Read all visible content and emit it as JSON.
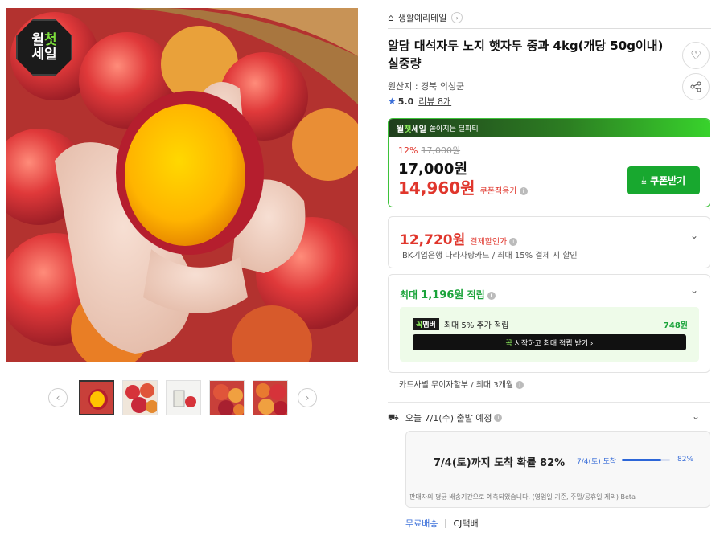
{
  "gallery": {
    "badge_line1": "월",
    "badge_line1_accent": "첫",
    "badge_line2": "세일",
    "thumbnails": [
      "thumb-1",
      "thumb-2",
      "thumb-3",
      "thumb-4",
      "thumb-5"
    ],
    "prev_icon": "chevron-left-icon",
    "next_icon": "chevron-right-icon"
  },
  "product": {
    "breadcrumb": "생활예리테일",
    "title": "알담 대석자두 노지 햇자두 중과 4kg(개당 50g이내) 실중량",
    "origin": "원산지 : 경북 의성군",
    "rating": "5.0",
    "review_link": "리뷰 8개"
  },
  "deal": {
    "header_prefix": "월",
    "header_accent": "첫",
    "header_suffix": "세일",
    "header_sub": "쏟아지는 딜파티",
    "discount_rate": "12%",
    "list_price": "17,000원",
    "sale_price": "17,000원",
    "coupon_price": "14,960원",
    "coupon_note": "쿠폰적용가",
    "coupon_button": "쿠폰받기"
  },
  "payment": {
    "price": "12,720원",
    "note": "결제할인가",
    "desc": "IBK기업은행 나라사랑카드 / 최대 15% 결제 시 할인"
  },
  "points": {
    "prefix": "최대",
    "amount": "1,196원",
    "suffix": "적립",
    "member_tag_accent": "꼭",
    "member_tag": "멤버",
    "member_text": "최대 5% 추가 적립",
    "member_amount": "748원",
    "cta_accent": "꼭",
    "cta": "시작하고 최대 적립 받기 ›"
  },
  "installment": "카드사별 무이자할부 / 최대 3개월",
  "shipping": {
    "departure": "오늘 7/1(수) 출발 예정",
    "arrival_headline": "7/4(토)까지 도착 확률 82%",
    "arrival_date": "7/4(토) 도착",
    "probability": 0.82,
    "probability_label": "82%",
    "footnote": "판매자의 평균 배송기간으로 예측되었습니다. (영업일 기준, 주말/공휴일 제외) Beta",
    "free_shipping": "무료배송",
    "carrier": "CJ택배"
  },
  "colors": {
    "accent_red": "#e0362c",
    "accent_green": "#1aa33a",
    "accent_blue": "#3b6fd9"
  }
}
